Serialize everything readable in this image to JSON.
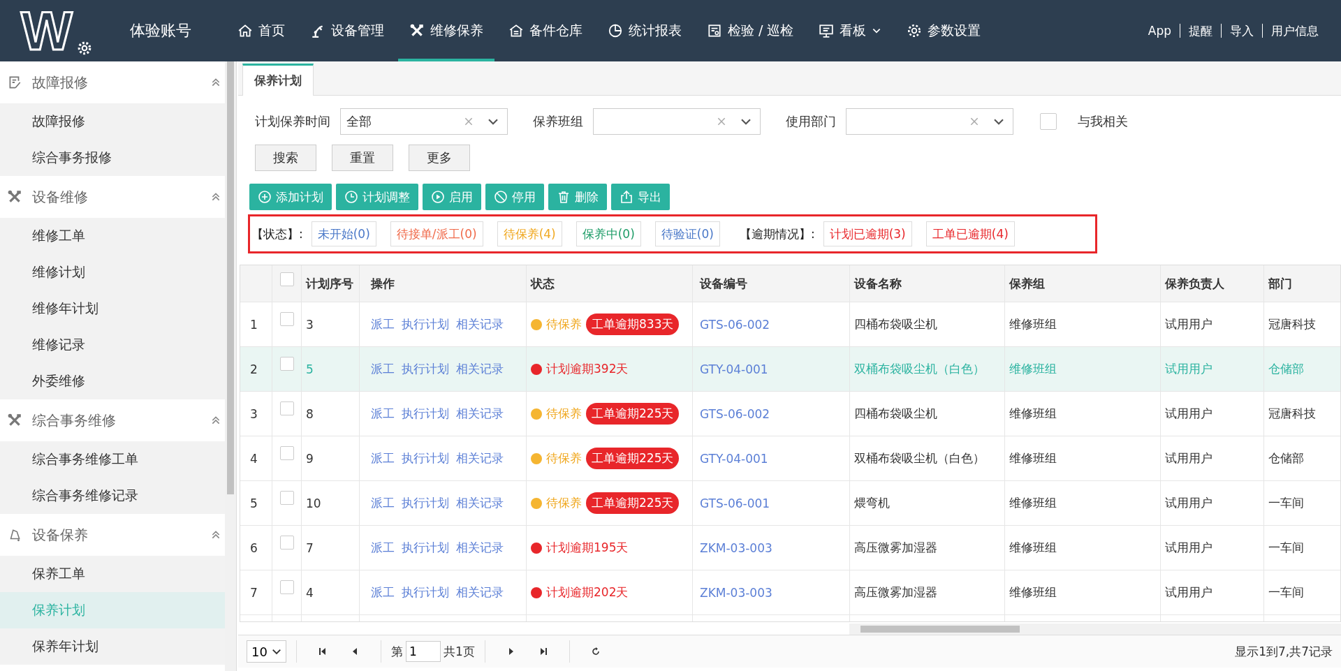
{
  "header": {
    "logo": "W",
    "account": "体验账号",
    "nav": [
      {
        "kind": "home",
        "label": "首页",
        "selected": false,
        "menu": false
      },
      {
        "kind": "arm",
        "label": "设备管理",
        "selected": false,
        "menu": false
      },
      {
        "kind": "tools",
        "label": "维修保养",
        "selected": true,
        "menu": false
      },
      {
        "kind": "warehouse",
        "label": "备件仓库",
        "selected": false,
        "menu": false
      },
      {
        "kind": "pie",
        "label": "统计报表",
        "selected": false,
        "menu": false
      },
      {
        "kind": "doc",
        "label": "检验 / 巡检",
        "selected": false,
        "menu": false
      },
      {
        "kind": "board",
        "label": "看板",
        "selected": false,
        "menu": true
      },
      {
        "kind": "gear",
        "label": "参数设置",
        "selected": false,
        "menu": false
      }
    ],
    "links": [
      "App",
      "提醒",
      "导入",
      "用户信息"
    ]
  },
  "sidebar": [
    {
      "kind": "form",
      "label": "故障报修",
      "expanded": true,
      "children": [
        {
          "label": "故障报修",
          "selected": false
        },
        {
          "label": "综合事务报修",
          "selected": false
        }
      ]
    },
    {
      "kind": "tools",
      "label": "设备维修",
      "expanded": true,
      "children": [
        {
          "label": "维修工单",
          "selected": false
        },
        {
          "label": "维修计划",
          "selected": false
        },
        {
          "label": "维修年计划",
          "selected": false
        },
        {
          "label": "维修记录",
          "selected": false
        },
        {
          "label": "外委维修",
          "selected": false
        }
      ]
    },
    {
      "kind": "tools",
      "label": "综合事务维修",
      "expanded": true,
      "children": [
        {
          "label": "综合事务维修工单",
          "selected": false
        },
        {
          "label": "综合事务维修记录",
          "selected": false
        }
      ]
    },
    {
      "kind": "bell",
      "label": "设备保养",
      "expanded": true,
      "children": [
        {
          "label": "保养工单",
          "selected": false
        },
        {
          "label": "保养计划",
          "selected": true
        },
        {
          "label": "保养年计划",
          "selected": false
        }
      ]
    }
  ],
  "tabs": [
    {
      "label": "保养计划",
      "selected": true
    }
  ],
  "filters": [
    {
      "label": "计划保养时间",
      "value": "全部"
    },
    {
      "label": "保养班组"
    },
    {
      "label": "使用部门"
    }
  ],
  "related": {
    "label": "与我相关",
    "checked": false
  },
  "search_buttons": [
    "搜索",
    "重置",
    "更多"
  ],
  "actions": [
    {
      "kind": "plus",
      "label": "添加计划"
    },
    {
      "kind": "clock",
      "label": "计划调整"
    },
    {
      "kind": "play",
      "label": "启用"
    },
    {
      "kind": "ban",
      "label": "停用"
    },
    {
      "kind": "trash",
      "label": "删除"
    },
    {
      "kind": "export",
      "label": "导出"
    }
  ],
  "status_filter": {
    "label": "【状态】:",
    "items": [
      {
        "label": "未开始(0)",
        "color": "#4a78c8"
      },
      {
        "label": "待接单/派工(0)",
        "color": "#f06a4a"
      },
      {
        "label": "待保养(4)",
        "color": "#f0a820"
      },
      {
        "label": "保养中(0)",
        "color": "#1f9d68"
      },
      {
        "label": "待验证(0)",
        "color": "#4a78c8"
      }
    ],
    "overdue_label": "【逾期情况】:",
    "overdue": [
      {
        "label": "计划已逾期(3)",
        "color": "#e8262a"
      },
      {
        "label": "工单已逾期(4)",
        "color": "#e8262a"
      }
    ]
  },
  "table": {
    "columns": [
      "计划序号",
      "操作",
      "状态",
      "设备编号",
      "设备名称",
      "保养组",
      "保养负责人",
      "部门"
    ],
    "all_checked": false,
    "rows": [
      {
        "index": "1",
        "checked": false,
        "selected": false,
        "no": "3",
        "actions": [
          "派工",
          "执行计划",
          "相关记录"
        ],
        "status": "待保养",
        "color": "#f5b531",
        "badge": "工单逾期833天",
        "code": "GTS-06-002",
        "name": "四桶布袋吸尘机",
        "group": "维修班组",
        "owner": "试用用户",
        "dept": "冠唐科技"
      },
      {
        "index": "2",
        "checked": false,
        "selected": true,
        "no": "5",
        "actions": [
          "派工",
          "执行计划",
          "相关记录"
        ],
        "status": "计划逾期392天",
        "color": "#e8262a",
        "code": "GTY-04-001",
        "name": "双桶布袋吸尘机（白色）",
        "group": "维修班组",
        "owner": "试用用户",
        "dept": "仓储部"
      },
      {
        "index": "3",
        "checked": false,
        "selected": false,
        "no": "8",
        "actions": [
          "派工",
          "执行计划",
          "相关记录"
        ],
        "status": "待保养",
        "color": "#f5b531",
        "badge": "工单逾期225天",
        "code": "GTS-06-002",
        "name": "四桶布袋吸尘机",
        "group": "维修班组",
        "owner": "试用用户",
        "dept": "冠唐科技"
      },
      {
        "index": "4",
        "checked": false,
        "selected": false,
        "no": "9",
        "actions": [
          "派工",
          "执行计划",
          "相关记录"
        ],
        "status": "待保养",
        "color": "#f5b531",
        "badge": "工单逾期225天",
        "code": "GTY-04-001",
        "name": "双桶布袋吸尘机（白色）",
        "group": "维修班组",
        "owner": "试用用户",
        "dept": "仓储部"
      },
      {
        "index": "5",
        "checked": false,
        "selected": false,
        "no": "10",
        "actions": [
          "派工",
          "执行计划",
          "相关记录"
        ],
        "status": "待保养",
        "color": "#f5b531",
        "badge": "工单逾期225天",
        "code": "GTS-06-001",
        "name": "煨弯机",
        "group": "维修班组",
        "owner": "试用用户",
        "dept": "一车间"
      },
      {
        "index": "6",
        "checked": false,
        "selected": false,
        "no": "7",
        "actions": [
          "派工",
          "执行计划",
          "相关记录"
        ],
        "status": "计划逾期195天",
        "color": "#e8262a",
        "code": "ZKM-03-003",
        "name": "高压微雾加湿器",
        "group": "维修班组",
        "owner": "试用用户",
        "dept": "一车间"
      },
      {
        "index": "7",
        "checked": false,
        "selected": false,
        "no": "4",
        "actions": [
          "派工",
          "执行计划",
          "相关记录"
        ],
        "status": "计划逾期202天",
        "color": "#e8262a",
        "code": "ZKM-03-003",
        "name": "高压微雾加湿器",
        "group": "维修班组",
        "owner": "试用用户",
        "dept": "一车间"
      }
    ]
  },
  "pager": {
    "page_size": "10",
    "page_prefix": "第",
    "page": "1",
    "total_pages": "共1页",
    "summary": "显示1到7,共7记录"
  }
}
